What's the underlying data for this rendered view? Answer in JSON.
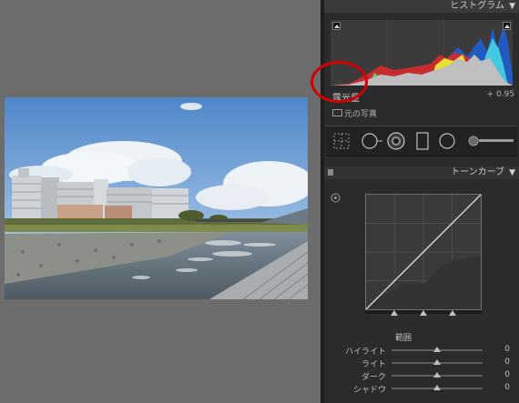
{
  "histogram_panel": {
    "title": "ヒストグラム",
    "exposure_label": "露光量",
    "exposure_value": "+ 0.95",
    "original_photo_label": "元の写真",
    "collapse_icon": "triangle-down-icon",
    "shadow_clip_icon": "shadow-clipping-icon",
    "highlight_clip_icon": "highlight-clipping-icon"
  },
  "tools": [
    {
      "icon": "crop-overlay-icon"
    },
    {
      "icon": "spot-removal-icon"
    },
    {
      "icon": "red-eye-icon"
    },
    {
      "icon": "graduated-filter-icon"
    },
    {
      "icon": "radial-filter-icon"
    },
    {
      "icon": "adjustment-brush-icon"
    }
  ],
  "tone_curve_panel": {
    "title": "トーンカーブ",
    "range_label": "範囲",
    "collapse_icon": "triangle-down-icon",
    "target_adjust_icon": "target-adjustment-icon",
    "sliders": [
      {
        "label": "ハイライト",
        "value": "0",
        "level": 0.5
      },
      {
        "label": "ライト",
        "value": "0",
        "level": 0.5
      },
      {
        "label": "ダーク",
        "value": "0",
        "level": 0.5
      },
      {
        "label": "シャドウ",
        "value": "0",
        "level": 0.5
      }
    ],
    "split_points": [
      0.25,
      0.5,
      0.75
    ]
  },
  "annotation": {
    "color": "#d40000",
    "target": "exposure-label"
  }
}
